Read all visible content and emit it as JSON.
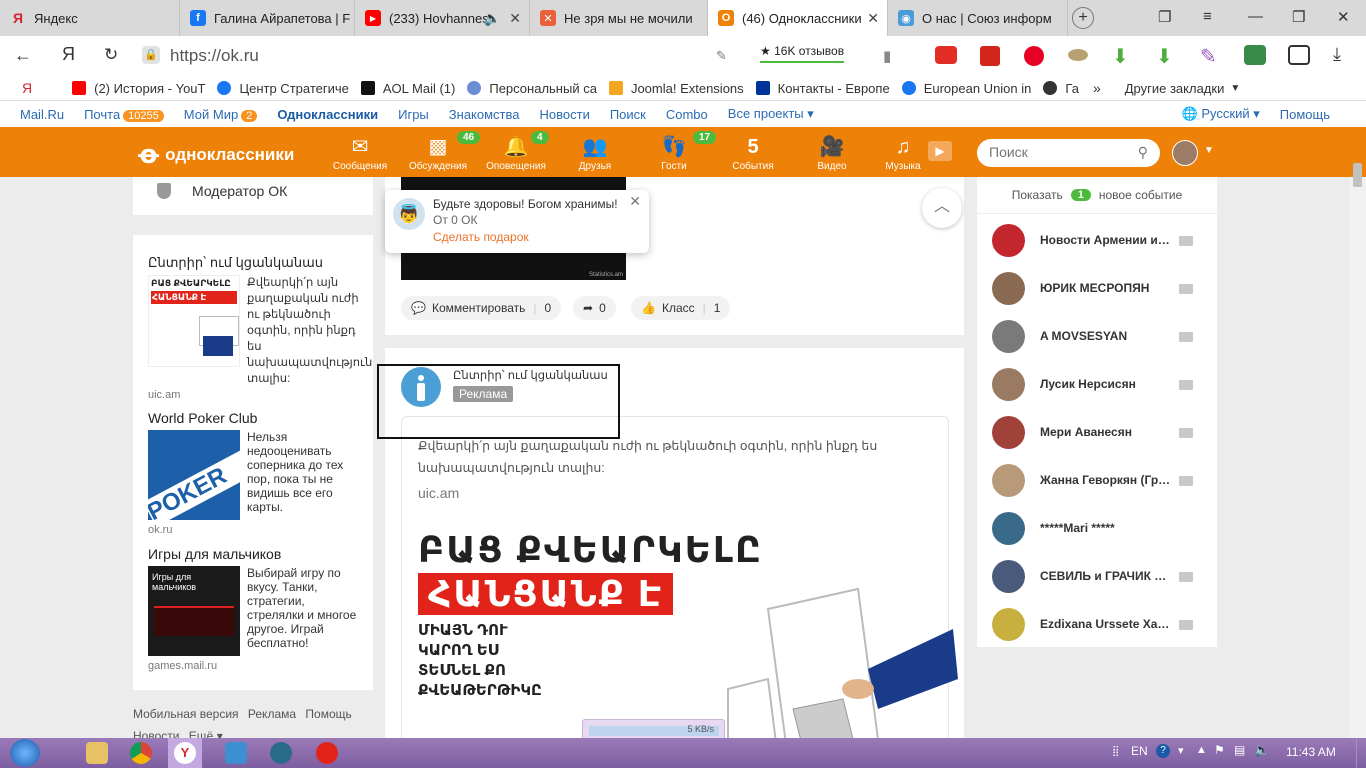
{
  "browser": {
    "tabs": [
      {
        "label": "Яндекс",
        "color": "#d6262f",
        "glyph": "Я"
      },
      {
        "label": "Галина Айрапетова | F",
        "color": "#1877f2",
        "glyph": "f"
      },
      {
        "label": "(233) Hovhannes",
        "color": "#ff0000",
        "glyph": "▶"
      },
      {
        "label": "Не зря мы не мочили",
        "color": "#e9603a",
        "glyph": "✕"
      },
      {
        "label": "(46) Одноклассники",
        "color": "#ee8208",
        "glyph": "О"
      },
      {
        "label": "О нас | Союз информ",
        "color": "#4b9bd6",
        "glyph": "◉"
      }
    ],
    "address": "https://ok.ru",
    "reviews": "★ 16K отзывов",
    "nav_back": "Я",
    "bookmarks": [
      {
        "label": "(2) История - YouT",
        "color": "#ff0000"
      },
      {
        "label": "Центр Стратегиче",
        "color": "#1877f2"
      },
      {
        "label": "AOL Mail (1)",
        "color": "#111111"
      },
      {
        "label": "Персональный са",
        "color": "#6b8fd6"
      },
      {
        "label": "Joomla! Extensions",
        "color": "#f4a521"
      },
      {
        "label": "Контакты - Европе",
        "color": "#003399"
      },
      {
        "label": "European Union in",
        "color": "#1877f2"
      },
      {
        "label": "Га",
        "color": "#333333"
      }
    ],
    "other_bookmarks": "Другие закладки"
  },
  "portal": {
    "items": [
      "Mail.Ru",
      "Почта",
      "Мой Мир",
      "Одноклассники",
      "Игры",
      "Знакомства",
      "Новости",
      "Поиск",
      "Combo",
      "Все проекты"
    ],
    "mail_count": "10255",
    "myworld_count": "2",
    "language": "Русский",
    "help": "Помощь"
  },
  "ok": {
    "logo": "одноклассники",
    "nav": [
      {
        "label": "Сообщения",
        "icon": "✉",
        "count": ""
      },
      {
        "label": "Обсуждения",
        "icon": "💬",
        "count": "46"
      },
      {
        "label": "Оповещения",
        "icon": "🔔",
        "count": "4"
      },
      {
        "label": "Друзья",
        "icon": "👥",
        "count": ""
      },
      {
        "label": "Гости",
        "icon": "👣",
        "count": "17"
      },
      {
        "label": "События",
        "icon": "5",
        "count": ""
      },
      {
        "label": "Видео",
        "icon": "🎥",
        "count": ""
      },
      {
        "label": "Музыка",
        "icon": "♫",
        "count": ""
      }
    ],
    "search_placeholder": "Поиск"
  },
  "left": {
    "moderator": "Модератор ОК",
    "ads": [
      {
        "title": "Ընտրիր՝ ում կցանկանաս",
        "text": "Քվեարկի՛ր այն քաղաքական ուժի ու թեկնածուի օգտին, որին ինքդ ես նախապատվություն տալիս:",
        "domain": "uic.am",
        "img_top": "ԲԱՑ ՔՎԵԱՐԿԵԼԸ",
        "img_bottom": "ՀԱՆՑԱՆՔ Է"
      },
      {
        "title": "World Poker Club",
        "text": "Нельзя недооценивать соперника до тех пор, пока ты не видишь все его карты.",
        "domain": "ok.ru",
        "img": "POKER"
      },
      {
        "title": "Игры для мальчиков",
        "text": "Выбирай игру по вкусу. Танки, стратегии, стрелялки и многое другое. Играй бесплатно!",
        "domain": "games.mail.ru",
        "img": "Игры для мальчиков"
      }
    ],
    "footer": [
      "Мобильная версия",
      "Реклама",
      "Помощь",
      "Новости",
      "Ещё"
    ]
  },
  "post1": {
    "comment": "Комментировать",
    "comment_count": "0",
    "share_count": "0",
    "like": "Класс",
    "like_count": "1",
    "watermark": "Statistics.am"
  },
  "popup": {
    "text": "Будьте здоровы! Богом хранимы!",
    "from": "От 0 ОК",
    "link": "Сделать подарок"
  },
  "post2": {
    "author": "Ընտրիր՝ ում կցանկանաս",
    "tag": "Реклама",
    "text": "Քվեարկի՛ր այն քաղաքական ուժի ու թեկնածուի օգտին, որին ինքդ ես նախապատվություն տալիս:",
    "domain": "uic.am",
    "headline1": "ԲԱՑ ՔՎԵԱՐԿԵԼԸ",
    "headline2": "ՀԱՆՑԱՆՔ Է",
    "lines": [
      "ՄԻԱՅՆ ԴՈՒ",
      "ԿԱՐՈՂ ԵՍ",
      "ՏԵՍՆԵԼ ՔՈ",
      "ՔՎԵԱԹԵՐԹԻԿԸ"
    ]
  },
  "right": {
    "show": "Показать",
    "count": "1",
    "new_event": "новое событие",
    "friends": [
      {
        "name": "Новости Армении и…",
        "color": "#c4262e"
      },
      {
        "name": "ЮРИК МЕСРОПЯН",
        "color": "#8a6a52"
      },
      {
        "name": "A MOVSESYAN",
        "color": "#7a7a7a"
      },
      {
        "name": "Лусик Нерсисян",
        "color": "#9a7a62"
      },
      {
        "name": "Мери Аванесян",
        "color": "#a0413a"
      },
      {
        "name": "Жанна Геворкян (Гр…",
        "color": "#b89a7a"
      },
      {
        "name": "*****Mari *****",
        "color": "#3a6a8a"
      },
      {
        "name": "СЕВИЛЬ и ГРАЧИК …",
        "color": "#4a5a7a"
      },
      {
        "name": "Ezdixana Urssete Xa…",
        "color": "#c8b040"
      }
    ]
  },
  "download": {
    "label": "5 KB/s"
  },
  "taskbar": {
    "lang": "EN",
    "time": "11:43 AM"
  }
}
